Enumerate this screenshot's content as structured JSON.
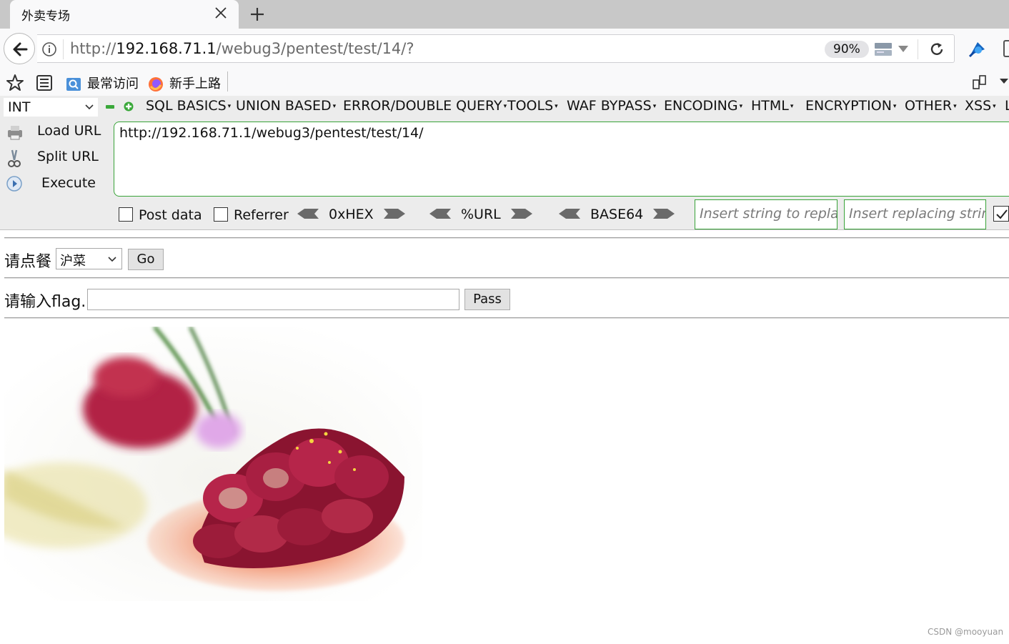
{
  "tab": {
    "title": "外卖专场"
  },
  "url": {
    "scheme": "http://",
    "host": "192.168.71.1",
    "path": "/webug3/pentest/test/14/?"
  },
  "toolbar": {
    "zoom": "90%"
  },
  "bookmarks": [
    {
      "label": "最常访问",
      "icon": "folder-search-icon"
    },
    {
      "label": "新手上路",
      "icon": "firefox-icon"
    }
  ],
  "hackbar": {
    "int_select": "INT",
    "menus": [
      "SQL BASICS",
      "UNION BASED",
      "ERROR/DOUBLE QUERY",
      "TOOLS",
      "WAF BYPASS",
      "ENCODING",
      "HTML",
      "ENCRYPTION",
      "OTHER",
      "XSS",
      "L"
    ],
    "load_url": "Load URL",
    "split_url": "Split URL",
    "execute": "Execute",
    "url_value": "http://192.168.71.1/webug3/pentest/test/14/",
    "post_data": "Post data",
    "referrer": "Referrer",
    "enc_hex": "0xHEX",
    "enc_url": "%URL",
    "enc_b64": "BASE64",
    "replace_placeholder": "Insert string to replace",
    "replacing_placeholder": "Insert replacing string"
  },
  "page": {
    "order_label": "请点餐",
    "order_selected": "沪菜",
    "go_label": "Go",
    "flag_label": "请输入flag.",
    "pass_label": "Pass"
  },
  "watermark": "CSDN @mooyuan"
}
